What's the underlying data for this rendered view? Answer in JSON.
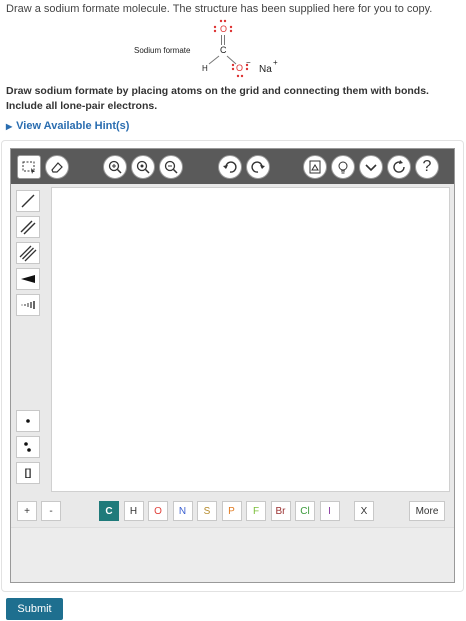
{
  "prompt": "Draw a sodium formate molecule. The structure has been supplied here for you to copy.",
  "molecule": {
    "name": "Sodium formate",
    "carbon": "C",
    "hydrogen": "H",
    "oxygen_top": "O",
    "oxygen_bottom": "O",
    "minus": "−",
    "cation": "Na",
    "plus": "+"
  },
  "instruction": "Draw sodium formate by placing atoms on the grid and connecting them with bonds. Include all lone-pair electrons.",
  "hint_link": "View Available Hint(s)",
  "atom_bar": {
    "plus": "+",
    "minus": "-",
    "atoms": [
      {
        "symbol": "C",
        "color": "#ffffff"
      },
      {
        "symbol": "H",
        "color": "#333333"
      },
      {
        "symbol": "O",
        "color": "#e0403a"
      },
      {
        "symbol": "N",
        "color": "#3a5fd0"
      },
      {
        "symbol": "S",
        "color": "#b58a2a"
      },
      {
        "symbol": "P",
        "color": "#e07a20"
      },
      {
        "symbol": "F",
        "color": "#7abf3a"
      },
      {
        "symbol": "Br",
        "color": "#9a3030"
      },
      {
        "symbol": "Cl",
        "color": "#3a9a3a"
      },
      {
        "symbol": "I",
        "color": "#8a3aa0"
      }
    ],
    "clear": "X",
    "more": "More"
  },
  "lone_pair_tools": {
    "bracket": "[]"
  },
  "toolbar_help": "?",
  "submit": "Submit"
}
